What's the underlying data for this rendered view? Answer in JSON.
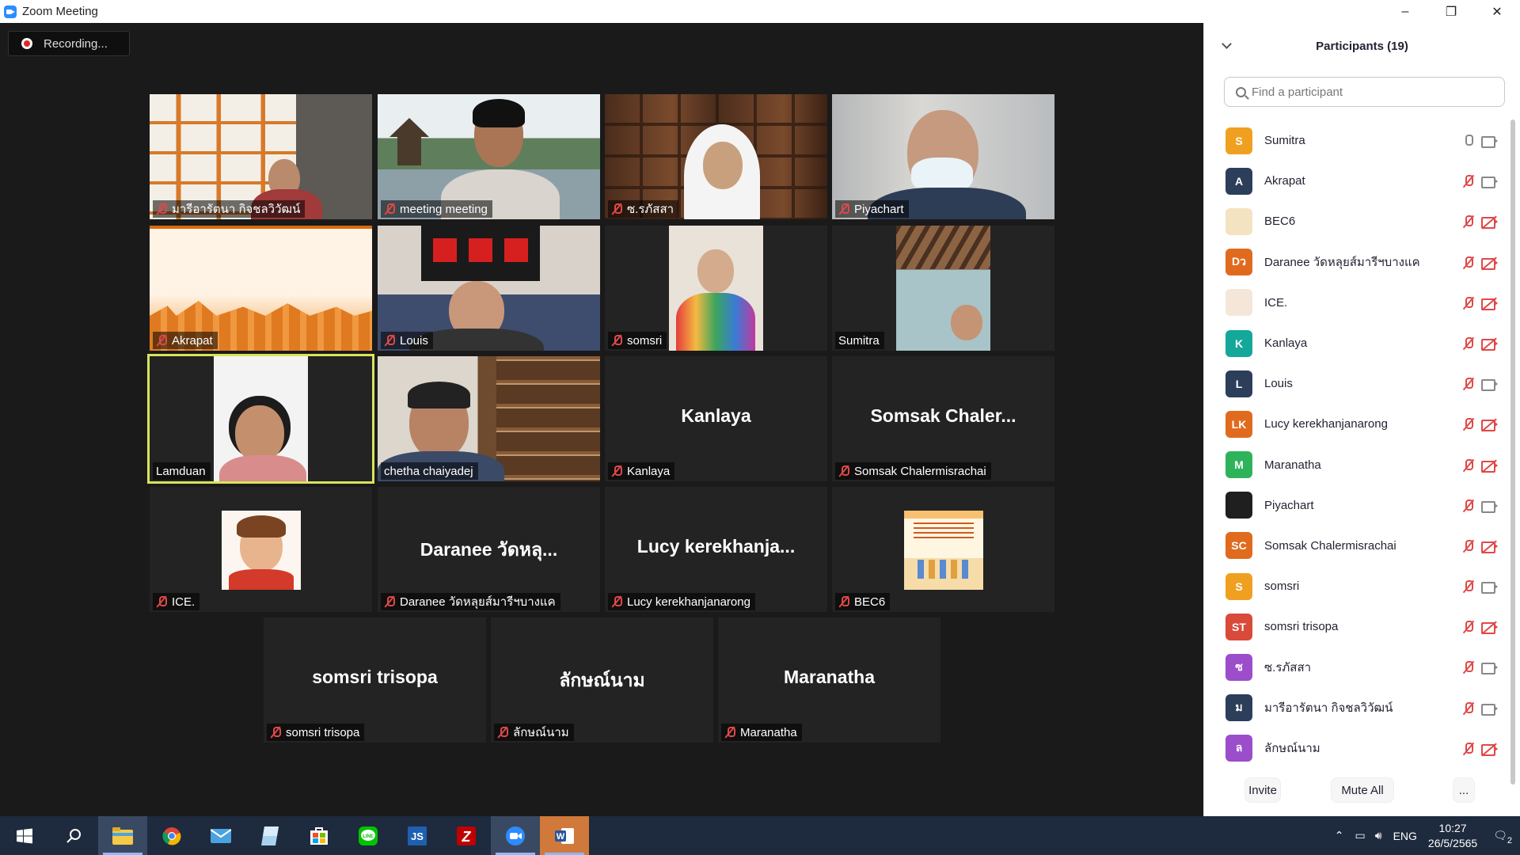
{
  "window": {
    "title": "Zoom Meeting"
  },
  "recording": {
    "label": "Recording..."
  },
  "tiles": [
    {
      "big": "",
      "label": "มารีอารัตนา กิจชลวิวัฒน์",
      "muted": true
    },
    {
      "big": "",
      "label": "meeting meeting",
      "muted": true
    },
    {
      "big": "",
      "label": "ซ.รภัสสา",
      "muted": true
    },
    {
      "big": "",
      "label": "Piyachart",
      "muted": true
    },
    {
      "big": "",
      "label": "Akrapat",
      "muted": true
    },
    {
      "big": "",
      "label": "Louis",
      "muted": true
    },
    {
      "big": "",
      "label": "somsri",
      "muted": true
    },
    {
      "big": "",
      "label": "Sumitra",
      "muted": false
    },
    {
      "big": "",
      "label": "Lamduan",
      "muted": false
    },
    {
      "big": "",
      "label": "chetha chaiyadej",
      "muted": false
    },
    {
      "big": "Kanlaya",
      "label": "Kanlaya",
      "muted": true
    },
    {
      "big": "Somsak  Chaler...",
      "label": "Somsak Chalermisrachai",
      "muted": true
    },
    {
      "big": "",
      "label": "ICE.",
      "muted": true
    },
    {
      "big": "Daranee  วัดหลุ...",
      "label": "Daranee วัดหลุยส์มารีฯบางแค",
      "muted": true
    },
    {
      "big": "Lucy  kerekhanja...",
      "label": "Lucy kerekhanjanarong",
      "muted": true
    },
    {
      "big": "",
      "label": "BEC6",
      "muted": true
    },
    {
      "big": "somsri trisopa",
      "label": "somsri trisopa",
      "muted": true
    },
    {
      "big": "ลักษณ์นาม",
      "label": "ลักษณ์นาม",
      "muted": true
    },
    {
      "big": "Maranatha",
      "label": "Maranatha",
      "muted": true
    }
  ],
  "participants": {
    "header": "Participants (19)",
    "search_placeholder": "Find a participant",
    "items": [
      {
        "initials": "S",
        "name": "Sumitra",
        "color": "#f0a020",
        "mic": "on",
        "cam": "on"
      },
      {
        "initials": "A",
        "name": "Akrapat",
        "color": "#2c3e5a",
        "mic": "muted",
        "cam": "on"
      },
      {
        "initials": "",
        "name": "BEC6",
        "color": "#f3e3c0",
        "mic": "muted",
        "cam": "off"
      },
      {
        "initials": "Dว",
        "name": "Daranee วัดหลุยส์มารีฯบางแค",
        "color": "#e06b1f",
        "mic": "muted",
        "cam": "off"
      },
      {
        "initials": "",
        "name": "ICE.",
        "color": "#f5e6da",
        "mic": "muted",
        "cam": "off"
      },
      {
        "initials": "K",
        "name": "Kanlaya",
        "color": "#14a89a",
        "mic": "muted",
        "cam": "off"
      },
      {
        "initials": "L",
        "name": "Louis",
        "color": "#2c3e5a",
        "mic": "muted",
        "cam": "on"
      },
      {
        "initials": "LK",
        "name": "Lucy kerekhanjanarong",
        "color": "#e06b1f",
        "mic": "muted",
        "cam": "off"
      },
      {
        "initials": "M",
        "name": "Maranatha",
        "color": "#2fb35a",
        "mic": "muted",
        "cam": "off"
      },
      {
        "initials": "",
        "name": "Piyachart",
        "color": "#1f1f1f",
        "mic": "muted",
        "cam": "on"
      },
      {
        "initials": "SC",
        "name": "Somsak Chalermisrachai",
        "color": "#e06b1f",
        "mic": "muted",
        "cam": "off"
      },
      {
        "initials": "S",
        "name": "somsri",
        "color": "#f0a020",
        "mic": "muted",
        "cam": "on"
      },
      {
        "initials": "ST",
        "name": "somsri trisopa",
        "color": "#d94a3a",
        "mic": "muted",
        "cam": "off"
      },
      {
        "initials": "ซ",
        "name": "ซ.รภัสสา",
        "color": "#9b4dca",
        "mic": "muted",
        "cam": "on"
      },
      {
        "initials": "ม",
        "name": "มารีอารัตนา กิจชลวิวัฒน์",
        "color": "#2c3e5a",
        "mic": "muted",
        "cam": "on"
      },
      {
        "initials": "ล",
        "name": "ลักษณ์นาม",
        "color": "#9b4dca",
        "mic": "muted",
        "cam": "off"
      }
    ],
    "buttons": {
      "invite": "Invite",
      "mute_all": "Mute All",
      "more": "..."
    }
  },
  "taskbar": {
    "apps": [
      "start-icon",
      "search-icon",
      "file-explorer-icon",
      "chrome-icon",
      "mail-icon",
      "notes-icon",
      "store-icon",
      "line-icon",
      "pinyin-icon",
      "filezilla-icon",
      "zoom-icon",
      "word-icon"
    ],
    "language": "ENG",
    "time": "10:27",
    "date": "26/5/2565",
    "notifications": "2"
  }
}
